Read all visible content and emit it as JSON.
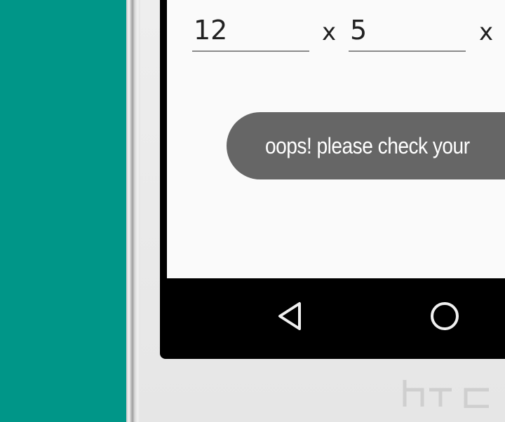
{
  "form": {
    "width_value": "12",
    "height_value": "5",
    "times_symbol": "x"
  },
  "toast": {
    "message": "oops! please check your"
  },
  "navigation": {
    "back_icon": "back-triangle-icon",
    "home_icon": "home-circle-icon"
  },
  "device": {
    "brand_logo": "htc"
  },
  "colors": {
    "background": "#009688",
    "toast_background": "#666666",
    "screen_background": "#fafafa"
  }
}
